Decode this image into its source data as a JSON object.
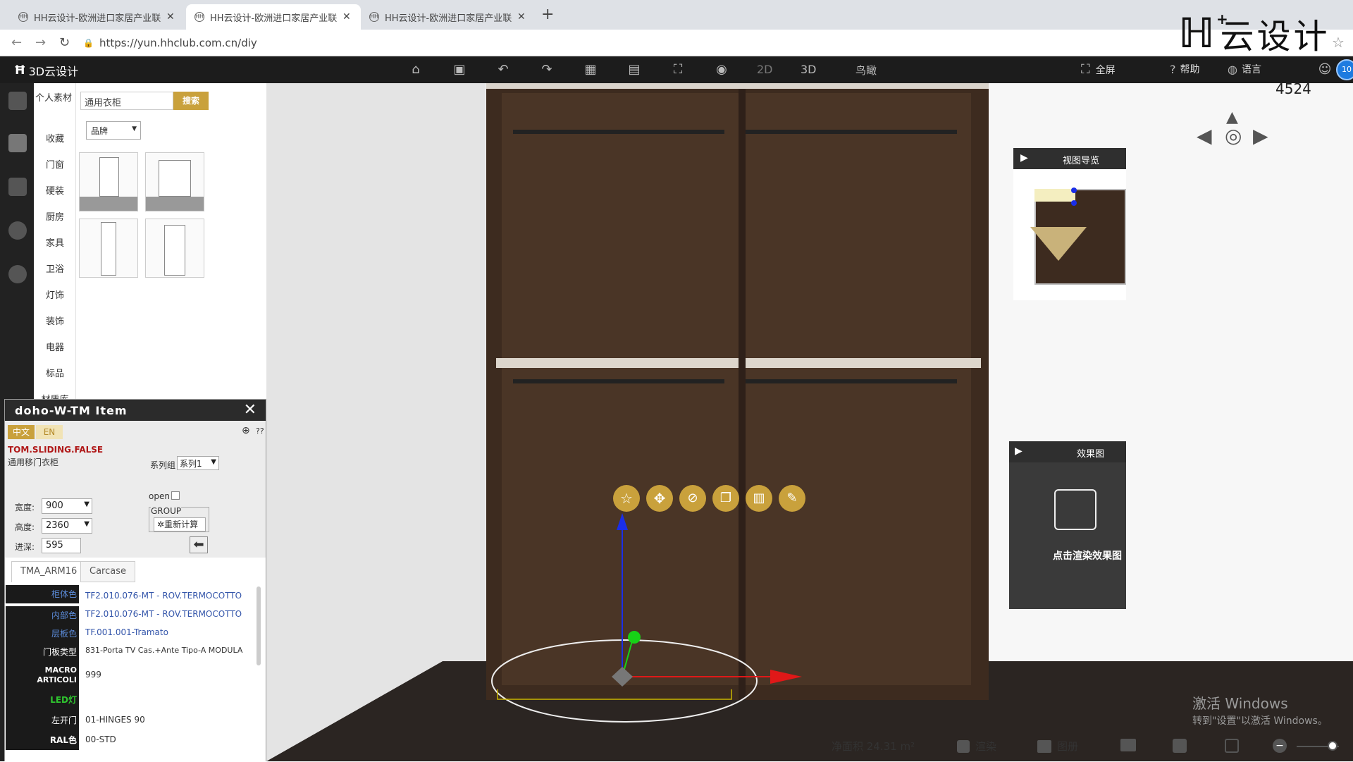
{
  "browser": {
    "tabs": [
      {
        "label": "HH云设计-欧洲进口家居产业联盟",
        "active": false
      },
      {
        "label": "HH云设计-欧洲进口家居产业联盟",
        "active": true
      },
      {
        "label": "HH云设计-欧洲进口家居产业联盟",
        "active": false
      }
    ],
    "favicon_text": "HH",
    "new_tab": "+",
    "url": "https://yun.hhclub.com.cn/diy",
    "back": "←",
    "forward": "→",
    "reload": "↻",
    "lock": "🔒",
    "star": "☆"
  },
  "brand": {
    "mark": "H",
    "mark_plus": "+",
    "text": "云设计"
  },
  "app": {
    "title": "3D云设计",
    "view_2d": "2D",
    "view_3d": "3D",
    "view_bird": "鸟瞰",
    "fullscreen": "全屏",
    "help": "帮助",
    "language": "语言",
    "user_badge": "10",
    "toolbar_icons": [
      "home-icon",
      "save-icon",
      "undo-icon",
      "redo-icon",
      "layout-icon",
      "box-icon",
      "select-icon",
      "eye-icon"
    ]
  },
  "categories": [
    "个人素材",
    "收藏",
    "门窗",
    "硬装",
    "厨房",
    "家具",
    "卫浴",
    "灯饰",
    "装饰",
    "电器",
    "标品",
    "材质库"
  ],
  "library": {
    "search_value": "通用衣柜",
    "search_button": "搜索",
    "brand_select": "品牌"
  },
  "props": {
    "title": "doho-W-TM Item",
    "lang_zh": "中文",
    "lang_en": "EN",
    "code": "TOM.SLIDING.FALSE",
    "name": "通用移门衣柜",
    "series_label": "系列组",
    "series_value": "系列1",
    "width_label": "宽度:",
    "width_value": "900",
    "height_label": "高度:",
    "height_value": "2360",
    "depth_label": "进深:",
    "depth_value": "595",
    "open_label": "open",
    "group_label": "GROUP",
    "recalc_button": "重新计算",
    "help_q": "??",
    "tabs": [
      "TMA_ARM16",
      "Carcase"
    ],
    "rows": [
      {
        "key": "柜体色",
        "value": "TF2.010.076-MT - ROV.TERMOCOTTO"
      },
      {
        "key": "内部色",
        "value": "TF2.010.076-MT - ROV.TERMOCOTTO"
      },
      {
        "key": "层板色",
        "value": "TF.001.001-Tramato"
      },
      {
        "key": "门板类型",
        "value": "831-Porta TV Cas.+Ante Tipo-A MODULA"
      },
      {
        "key": "MACRO ARTICOLI",
        "value": "999"
      },
      {
        "key": "LED灯",
        "value": ""
      },
      {
        "key": "左开门",
        "value": "01-HINGES 90"
      },
      {
        "key": "RAL色",
        "value": "00-STD"
      }
    ]
  },
  "viewport": {
    "dimension_label": "4524",
    "view_nav_title": "视图导览",
    "render_title": "效果图",
    "render_cta": "点击渲染效果图",
    "watermark_title": "激活 Windows",
    "watermark_sub": "转到\"设置\"以激活 Windows。",
    "gizmo_buttons": [
      "star-icon",
      "move-icon",
      "hide-icon",
      "copy-icon",
      "delete-icon",
      "edit-icon"
    ]
  },
  "status": {
    "area": "净面积 24.31 m²",
    "render": "渲染",
    "gallery": "图册"
  },
  "colors": {
    "wood_dark": "#3d2b1f",
    "wood_mid": "#4a3526",
    "gizmo_gold": "#c9a13c",
    "axis_red": "#e01818",
    "axis_blue": "#1a2ee8",
    "axis_green": "#17d217",
    "link_blue": "#3355aa",
    "key_blue": "#5b8bd9"
  }
}
